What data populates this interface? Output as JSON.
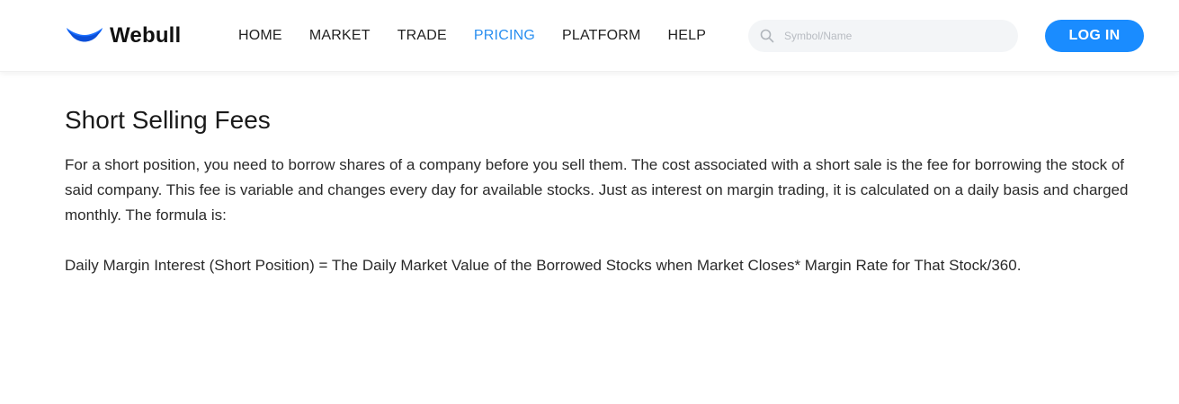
{
  "header": {
    "logo_text": "Webull",
    "nav": [
      {
        "label": "HOME",
        "active": false
      },
      {
        "label": "MARKET",
        "active": false
      },
      {
        "label": "TRADE",
        "active": false
      },
      {
        "label": "PRICING",
        "active": true
      },
      {
        "label": "PLATFORM",
        "active": false
      },
      {
        "label": "HELP",
        "active": false
      }
    ],
    "search": {
      "placeholder": "Symbol/Name",
      "value": ""
    },
    "login_label": "LOG IN"
  },
  "colors": {
    "brand_blue": "#1a8cff",
    "active_nav": "#2a8ff0"
  },
  "main": {
    "title": "Short Selling Fees",
    "paragraphs": [
      "For a short position, you need to borrow shares of a company before you sell them. The cost associated with a short sale is the fee for borrowing the stock of said company. This fee is variable and changes every day for available stocks. Just as interest on margin trading, it is calculated on a daily basis and charged monthly. The formula is:",
      "Daily Margin Interest (Short Position) = The Daily Market Value of the Borrowed Stocks when Market Closes* Margin Rate for That Stock/360."
    ]
  }
}
